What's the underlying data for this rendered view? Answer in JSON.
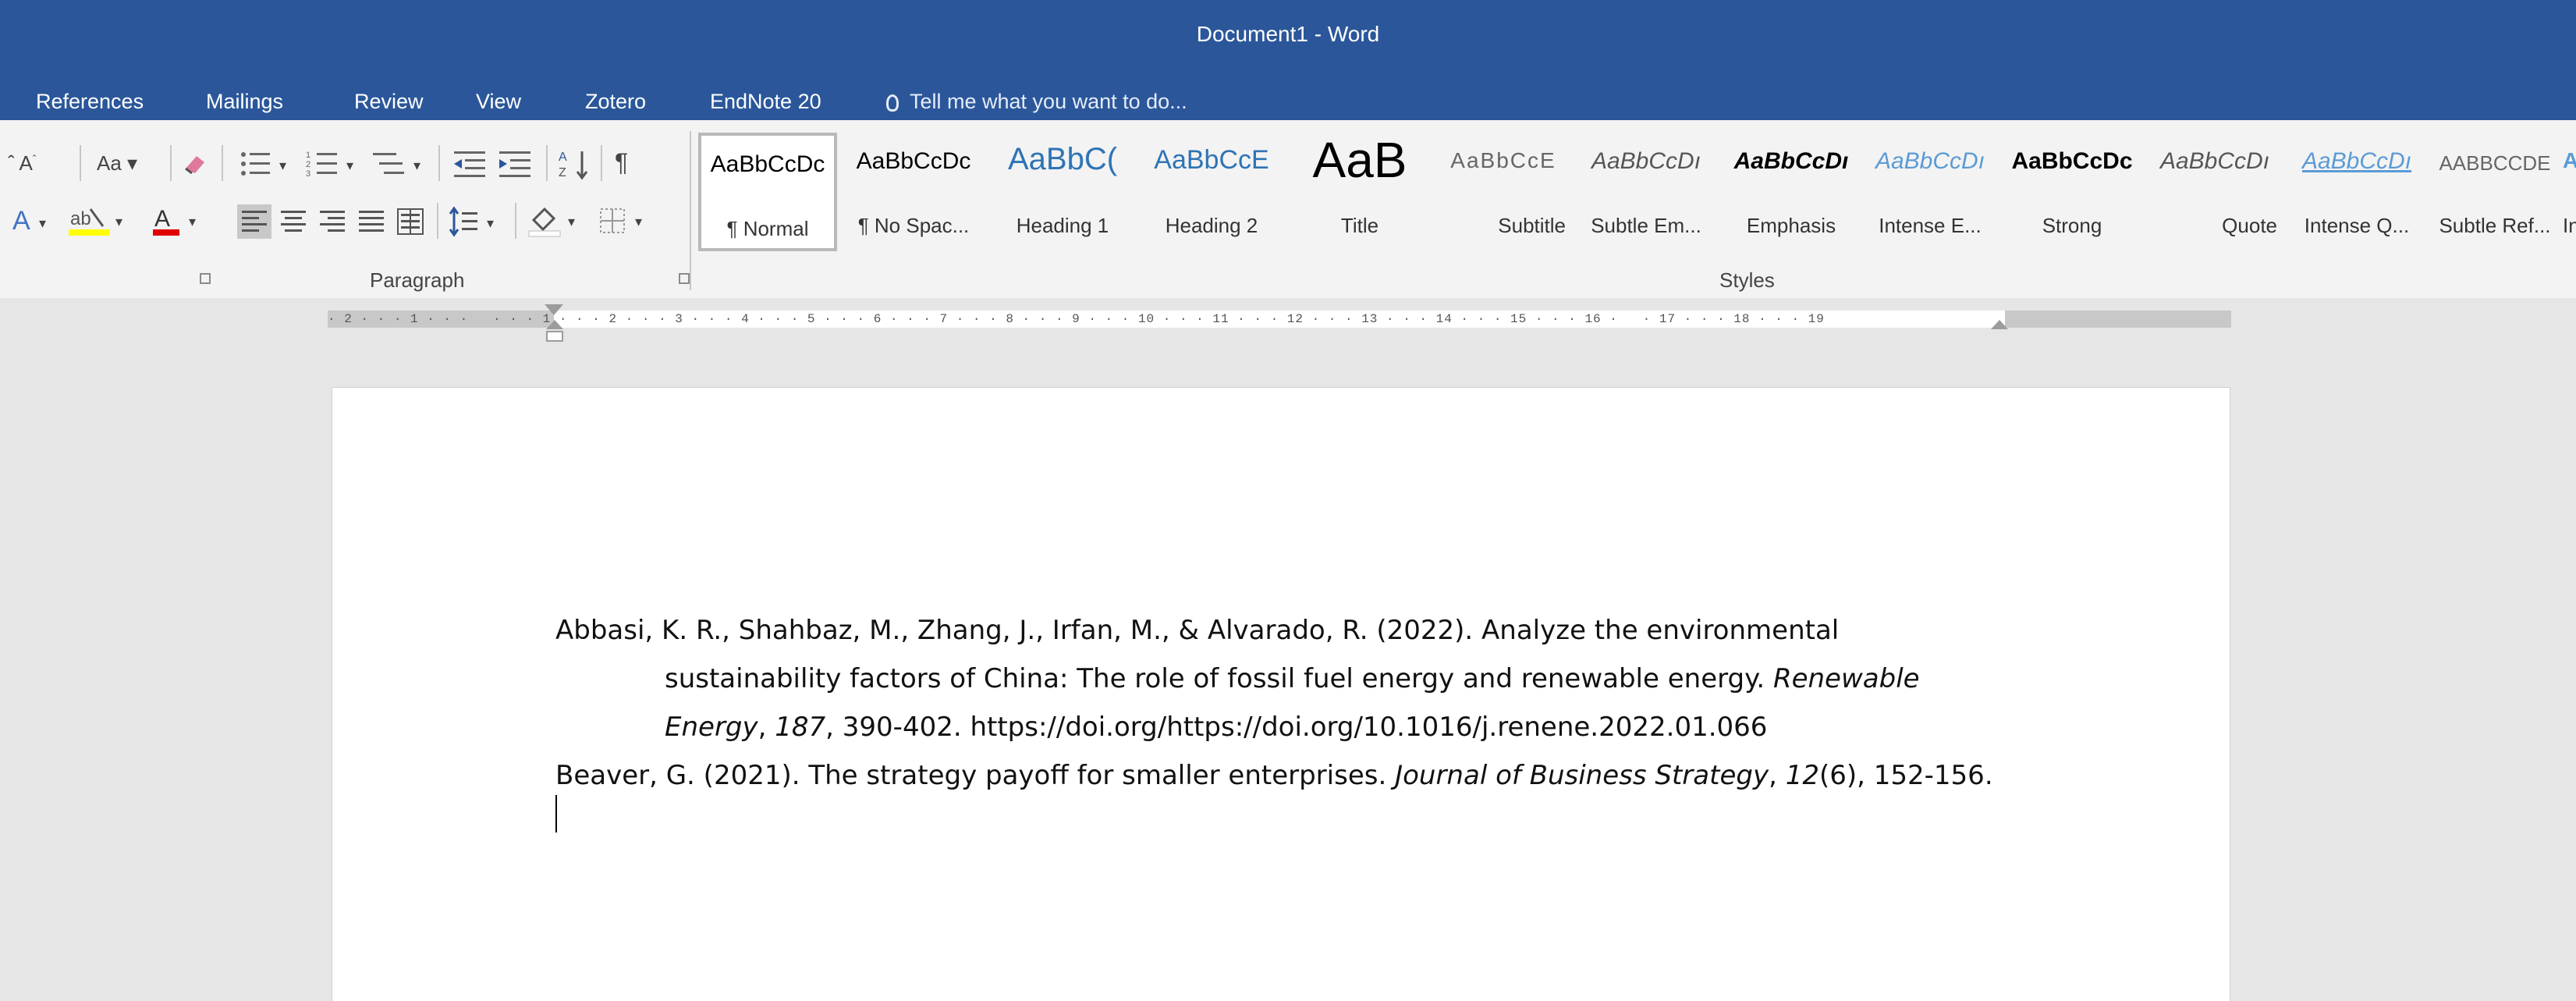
{
  "window": {
    "title": "Document1 - Word"
  },
  "tabs": [
    {
      "label": "References"
    },
    {
      "label": "Mailings"
    },
    {
      "label": "Review"
    },
    {
      "label": "View"
    },
    {
      "label": "Zotero"
    },
    {
      "label": "EndNote 20"
    }
  ],
  "tell_me": {
    "placeholder": "Tell me what you want to do..."
  },
  "ribbon": {
    "font_group": {
      "change_case_label": "Aa"
    },
    "paragraph_group": {
      "label": "Paragraph",
      "show_hide_symbol": "¶"
    },
    "styles_group": {
      "label": "Styles"
    },
    "styles": [
      {
        "sample": "AaBbCcDc",
        "name": "¶ Normal",
        "selected": true
      },
      {
        "sample": "AaBbCcDc",
        "name": "¶ No Spac..."
      },
      {
        "sample": "AaBbC(",
        "name": "Heading 1"
      },
      {
        "sample": "AaBbCcE",
        "name": "Heading 2"
      },
      {
        "sample": "AaB",
        "name": "Title"
      },
      {
        "sample": "AaBbCcE",
        "name": "Subtitle"
      },
      {
        "sample": "AaBbCcDı",
        "name": "Subtle Em..."
      },
      {
        "sample": "AaBbCcDı",
        "name": "Emphasis"
      },
      {
        "sample": "AaBbCcDı",
        "name": "Intense E..."
      },
      {
        "sample": "AaBbCcDc",
        "name": "Strong"
      },
      {
        "sample": "AaBbCcDı",
        "name": "Quote"
      },
      {
        "sample": "AaBbCcDı",
        "name": "Intense Q..."
      },
      {
        "sample": "AABBCCDE",
        "name": "Subtle Ref..."
      },
      {
        "sample": "AA",
        "name": "Inte"
      }
    ]
  },
  "ruler": {
    "labels": "· 2 · · · 1 · · ·   · · · 1 · · · 2 · · · 3 · · · 4 · · · 5 · · · 6 · · · 7 · · · 8 · · · 9 · · · 10 · · · 11 · · · 12 · · · 13 · · · 14 · · · 15 · · · 16 ·   · 17 · · · 18 · · · 19"
  },
  "document": {
    "references": [
      {
        "prefix": "Abbasi, K. R., Shahbaz, M., Zhang, J., Irfan, M., & Alvarado, R. (2022). Analyze the environmental",
        "line2": "sustainability factors of China: The role of fossil fuel energy and renewable energy. ",
        "journal": "Renewable",
        "journal2": "Energy",
        "sep1": ", ",
        "volume": "187",
        "rest": ", 390-402. https://doi.org/https://doi.org/10.1016/j.renene.2022.01.066"
      },
      {
        "prefix": "Beaver, G. (2021). The strategy payoff for smaller enterprises. ",
        "journal": "Journal of Business Strategy",
        "sep1": ", ",
        "volume": "12",
        "issue": "(6)",
        "rest": ", 152-156."
      }
    ]
  }
}
